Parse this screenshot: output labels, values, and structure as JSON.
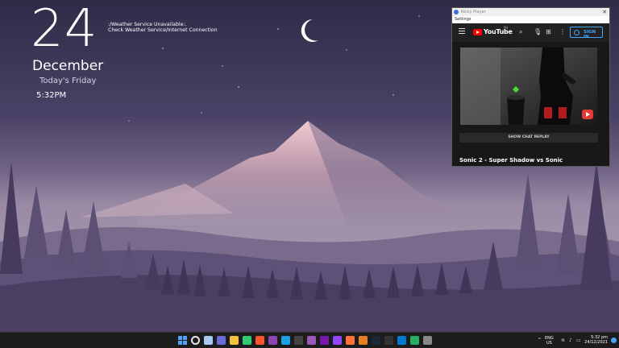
{
  "desktop": {
    "day": "24",
    "month": "December",
    "weekday": "Today's Friday",
    "time": "5:32PM",
    "weather_line1": ":/Weather Service Unavailable:.",
    "weather_line2": "Check Weather Service/Internet Connection"
  },
  "player": {
    "window_title": "Nicky Player",
    "menu_settings": "Settings",
    "header": {
      "logo_text": "YouTube",
      "logo_sup": "PH",
      "signin_label": "SIGN IN"
    },
    "show_chat_replay": "SHOW CHAT REPLAY",
    "video_title": "Sonic 2 - Super Shadow vs Sonic"
  },
  "taskbar": {
    "apps": [
      {
        "icon": "windows-start-icon",
        "color": "#4fa3f7"
      },
      {
        "icon": "search-icon",
        "color": "#e6e6e6"
      },
      {
        "icon": "task-view-icon",
        "color": "#a8c8f0"
      },
      {
        "icon": "chat-icon",
        "color": "#6b6bd8"
      },
      {
        "icon": "file-explorer-icon",
        "color": "#f3c13a"
      },
      {
        "icon": "app-green-icon",
        "color": "#2ecc71"
      },
      {
        "icon": "brave-icon",
        "color": "#fb542b"
      },
      {
        "icon": "app-colorful-icon",
        "color": "#8e44ad"
      },
      {
        "icon": "edge-icon",
        "color": "#1ba1e2"
      },
      {
        "icon": "app-dark-icon",
        "color": "#444444"
      },
      {
        "icon": "app-purple-icon",
        "color": "#9b59b6"
      },
      {
        "icon": "onenote-icon",
        "color": "#7719aa"
      },
      {
        "icon": "twitch-icon",
        "color": "#9146ff"
      },
      {
        "icon": "firefox-icon",
        "color": "#ff7139"
      },
      {
        "icon": "app-orange-icon",
        "color": "#e67e22"
      },
      {
        "icon": "steam-icon",
        "color": "#1b2838"
      },
      {
        "icon": "terminal-icon",
        "color": "#333333"
      },
      {
        "icon": "vscode-icon",
        "color": "#007acc"
      },
      {
        "icon": "app-colorful2-icon",
        "color": "#27ae60"
      },
      {
        "icon": "settings-gear-icon",
        "color": "#888888"
      }
    ],
    "lang_line1": "ENG",
    "lang_line2": "US",
    "clock_time": "5:32 pm",
    "clock_date": "24/12/2021"
  }
}
